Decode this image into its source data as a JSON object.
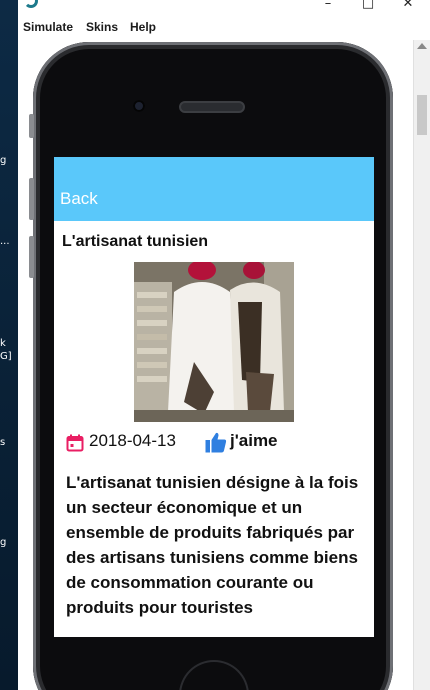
{
  "window": {
    "menu": [
      "Simulate",
      "Skins",
      "Help"
    ]
  },
  "desktop": {
    "fragments": [
      "g",
      "...",
      "k",
      "G]",
      "s",
      "g"
    ]
  },
  "app": {
    "back_label": "Back",
    "title": "L'artisanat tunisien",
    "date": "2018-04-13",
    "like_label": "j'aime",
    "body": "L'artisanat tunisien désigne à la fois un secteur économique et un ensemble de produits fabriqués par des artisans tunisiens comme biens de consommation courante ou produits pour touristes",
    "colors": {
      "header": "#5ac8fa",
      "calendar": "#e91e63",
      "like": "#2f7fe0"
    },
    "icons": {
      "calendar": "calendar-icon",
      "like": "thumbs-up-icon"
    }
  }
}
